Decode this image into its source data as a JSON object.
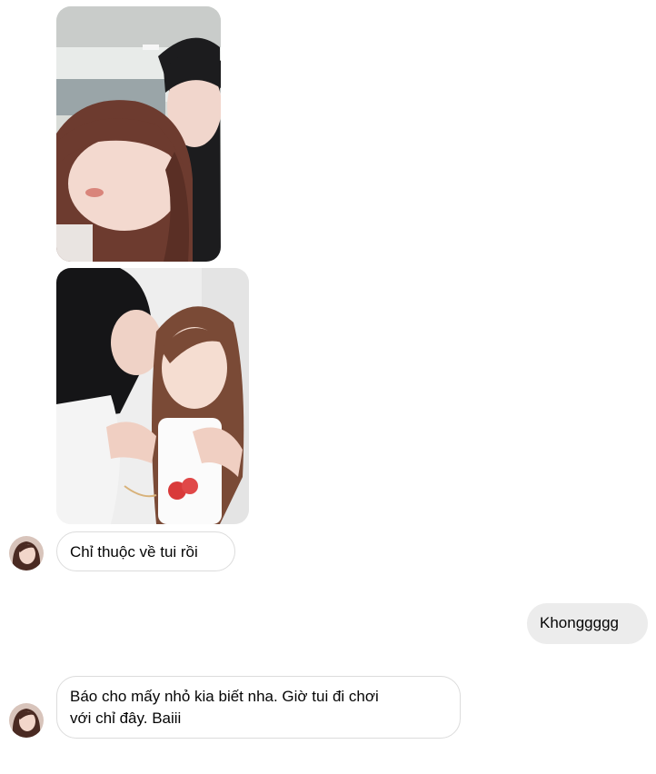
{
  "conversation": {
    "messages": [
      {
        "sender": "contact",
        "kind": "photo",
        "image_name": "selfie-two-girls-1"
      },
      {
        "sender": "contact",
        "kind": "photo",
        "image_name": "selfie-two-girls-2"
      },
      {
        "sender": "contact",
        "kind": "text",
        "text": "Chỉ thuộc về tui rồi"
      },
      {
        "sender": "me",
        "kind": "text",
        "text": "Khonggggg"
      },
      {
        "sender": "contact",
        "kind": "text",
        "lines": [
          "Báo cho mấy nhỏ kia biết nha. Giờ tui đi chơi",
          "với chỉ đây. Baiii"
        ]
      }
    ]
  },
  "colors": {
    "background": "#ffffff",
    "incoming_bubble": "#ffffff",
    "incoming_border": "#dcdcdc",
    "outgoing_bubble": "#ececec",
    "text": "#050505"
  }
}
